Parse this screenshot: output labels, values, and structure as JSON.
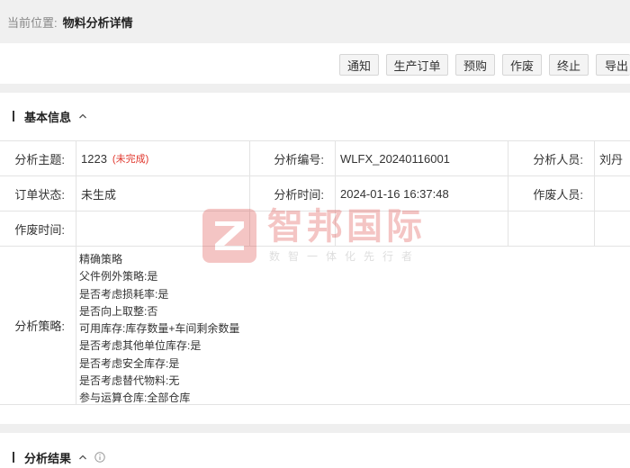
{
  "breadcrumb": {
    "prefix": "当前位置:",
    "current": "物料分析详情"
  },
  "toolbar": {
    "buttons": [
      {
        "label": "通知"
      },
      {
        "label": "生产订单"
      },
      {
        "label": "预购"
      },
      {
        "label": "作废"
      },
      {
        "label": "终止"
      },
      {
        "label": "导出"
      }
    ]
  },
  "basic_info": {
    "title": "基本信息",
    "fields": {
      "topic_label": "分析主题:",
      "topic_value": "1223",
      "topic_status": "(未完成)",
      "code_label": "分析编号:",
      "code_value": "WLFX_20240116001",
      "analyst_label": "分析人员:",
      "analyst_value": "刘丹",
      "order_status_label": "订单状态:",
      "order_status_value": "未生成",
      "time_label": "分析时间:",
      "time_value": "2024-01-16 16:37:48",
      "voider_label": "作废人员:",
      "voider_value": "",
      "void_time_label": "作废时间:",
      "void_time_value": "",
      "strategy_label": "分析策略:"
    },
    "strategy_lines": [
      "精确策略",
      "父件例外策略:是",
      "是否考虑损耗率:是",
      "是否向上取整:否",
      "可用库存:库存数量+车间剩余数量",
      "是否考虑其他单位库存:是",
      "是否考虑安全库存:是",
      "是否考虑替代物料:无",
      "参与运算仓库:全部仓库"
    ]
  },
  "result": {
    "title": "分析结果"
  },
  "watermark": {
    "main": "智邦国际",
    "sub": "数智一体化先行者"
  },
  "colors": {
    "status_red": "#e0352b",
    "watermark_red": "#d9332e",
    "gap_gray": "#efefef"
  }
}
